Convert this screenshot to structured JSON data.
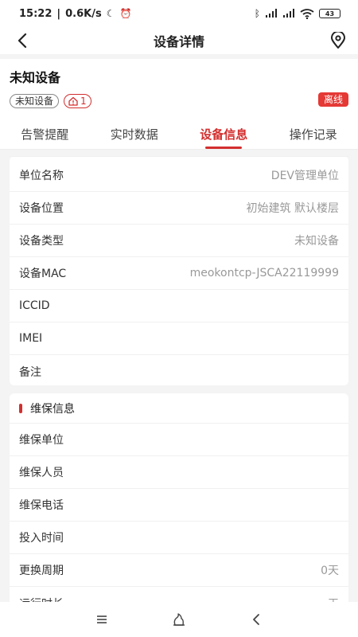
{
  "status_bar": {
    "time": "15:22",
    "network_speed": "0.6K/s",
    "battery": "43",
    "icons": [
      "moon-icon",
      "alarm-icon",
      "bluetooth-icon",
      "hd-signal-icon",
      "hd-signal-icon",
      "wifi-icon",
      "battery-icon"
    ]
  },
  "navbar": {
    "title": "设备详情",
    "back_icon": "chevron-left-icon",
    "location_icon": "location-pin-icon"
  },
  "device": {
    "name": "未知设备",
    "type_tag": "未知设备",
    "alarm_count": "1",
    "status": "离线"
  },
  "tabs": [
    {
      "label": "告警提醒",
      "active": false
    },
    {
      "label": "实时数据",
      "active": false
    },
    {
      "label": "设备信息",
      "active": true
    },
    {
      "label": "操作记录",
      "active": false
    }
  ],
  "device_info": [
    {
      "label": "单位名称",
      "value": "DEV管理单位"
    },
    {
      "label": "设备位置",
      "value": "初始建筑 默认楼层"
    },
    {
      "label": "设备类型",
      "value": "未知设备"
    },
    {
      "label": "设备MAC",
      "value": "meokontcp-JSCA22119999"
    },
    {
      "label": "ICCID",
      "value": ""
    },
    {
      "label": "IMEI",
      "value": ""
    },
    {
      "label": "备注",
      "value": ""
    }
  ],
  "maintenance": {
    "title": "维保信息",
    "rows": [
      {
        "label": "维保单位",
        "value": ""
      },
      {
        "label": "维保人员",
        "value": ""
      },
      {
        "label": "维保电话",
        "value": ""
      },
      {
        "label": "投入时间",
        "value": ""
      },
      {
        "label": "更换周期",
        "value": "0天"
      },
      {
        "label": "运行时长",
        "value": "天"
      }
    ]
  },
  "colors": {
    "accent": "#d32f2f",
    "badge_offline": "#e53935"
  }
}
